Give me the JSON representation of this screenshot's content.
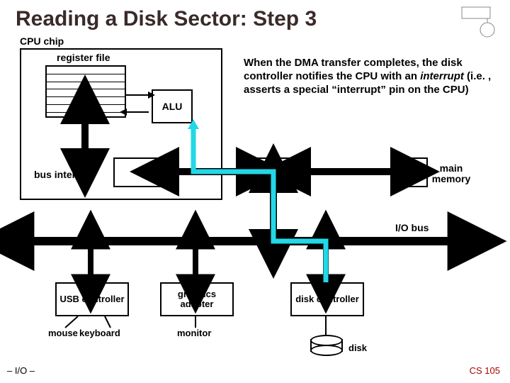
{
  "title": "Reading a Disk Sector: Step 3",
  "cpu_chip_label": "CPU chip",
  "register_file_label": "register file",
  "alu_label": "ALU",
  "bus_interface_label": "bus interface",
  "caption_part1": "When the DMA transfer completes, the disk controller notifies the CPU with an ",
  "caption_em": "interrupt",
  "caption_part2": " (i.e. , asserts a special “interrupt” pin on the CPU)",
  "main_memory_label": "main memory",
  "io_bus_label": "I/O bus",
  "devices": {
    "usb": "USB controller",
    "graphics": "graphics adapter",
    "disk_ctrl": "disk controller"
  },
  "peripherals": {
    "mouse": "mouse",
    "keyboard": "keyboard",
    "monitor": "monitor",
    "disk": "disk"
  },
  "footer_left": "– I/O –",
  "footer_right": "CS 105"
}
